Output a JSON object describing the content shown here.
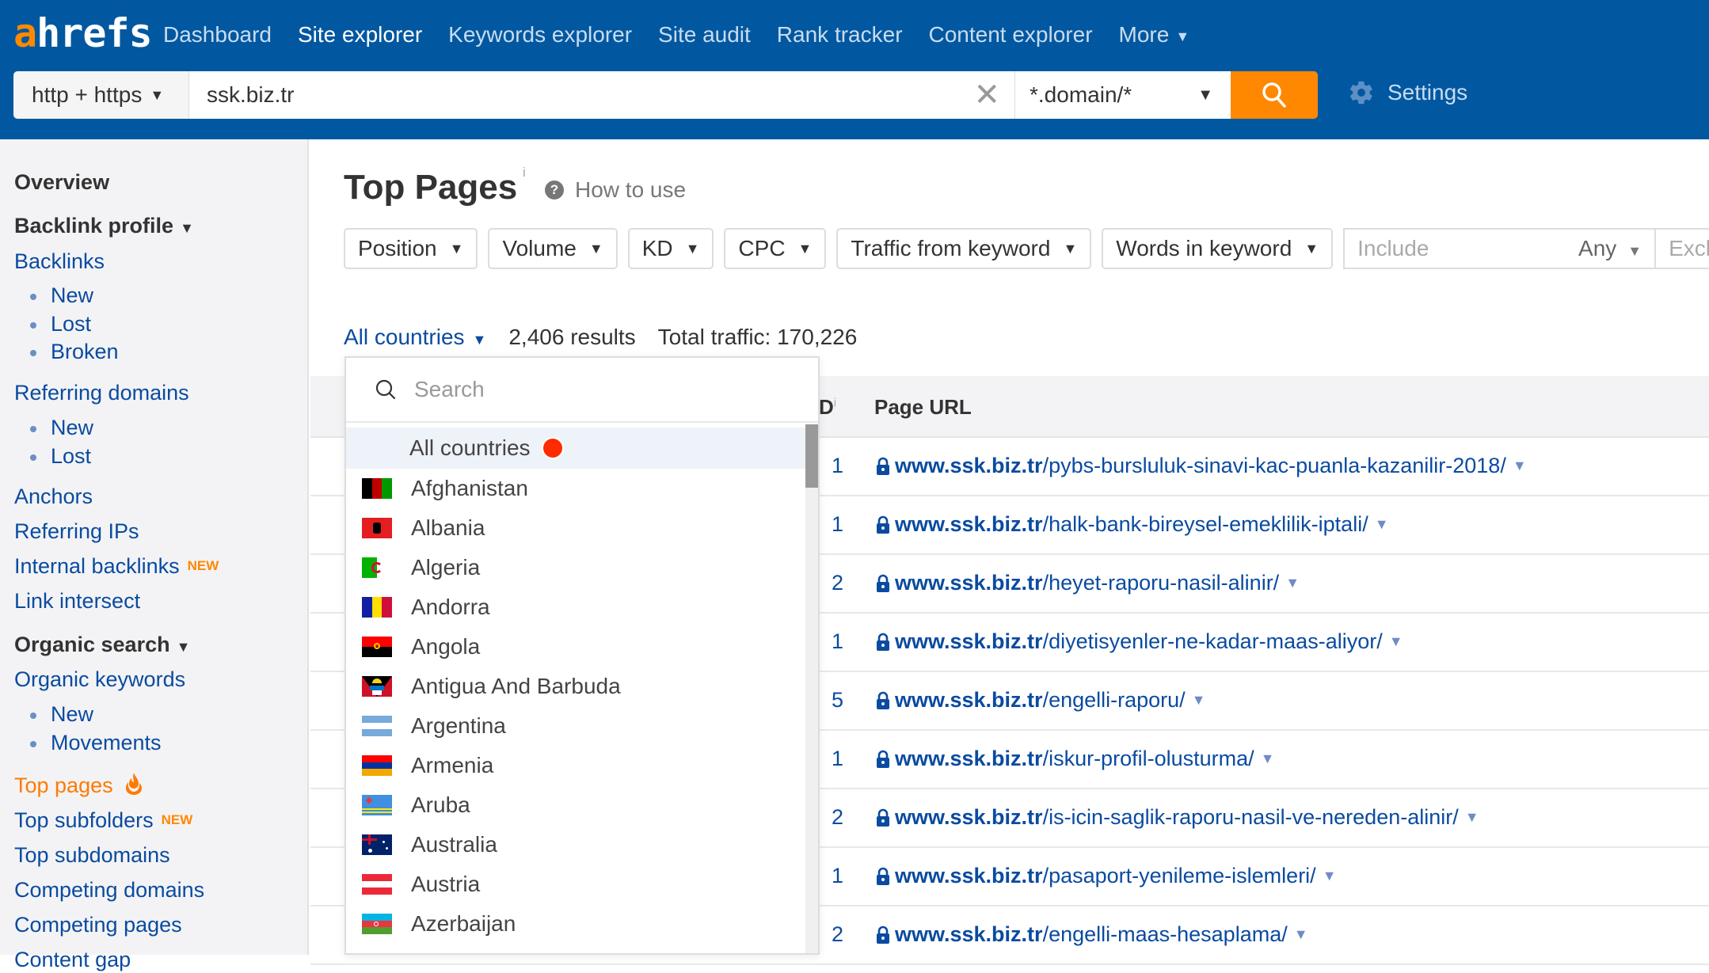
{
  "app": {
    "logo_a": "a",
    "logo_rest": "hrefs",
    "brand_color": "#0158a0",
    "accent_color": "#ff8800"
  },
  "nav": {
    "items": [
      {
        "label": "Dashboard",
        "active": false
      },
      {
        "label": "Site explorer",
        "active": true
      },
      {
        "label": "Keywords explorer",
        "active": false
      },
      {
        "label": "Site audit",
        "active": false
      },
      {
        "label": "Rank tracker",
        "active": false
      },
      {
        "label": "Content explorer",
        "active": false
      },
      {
        "label": "More",
        "active": false
      }
    ]
  },
  "search": {
    "protocol": "http + https",
    "target_value": "ssk.biz.tr",
    "mode": "*.domain/*",
    "settings_label": "Settings"
  },
  "sidebar": {
    "overview": "Overview",
    "backlink_profile": "Backlink profile",
    "backlinks": "Backlinks",
    "backlinks_new": "New",
    "backlinks_lost": "Lost",
    "backlinks_broken": "Broken",
    "referring_domains": "Referring domains",
    "rd_new": "New",
    "rd_lost": "Lost",
    "anchors": "Anchors",
    "referring_ips": "Referring IPs",
    "internal_backlinks": "Internal backlinks",
    "internal_backlinks_badge": "NEW",
    "link_intersect": "Link intersect",
    "organic_search": "Organic search",
    "organic_keywords": "Organic keywords",
    "ok_new": "New",
    "ok_movements": "Movements",
    "top_pages": "Top pages",
    "top_subfolders": "Top subfolders",
    "top_subfolders_badge": "NEW",
    "top_subdomains": "Top subdomains",
    "competing_domains": "Competing domains",
    "competing_pages": "Competing pages",
    "content_gap": "Content gap"
  },
  "main": {
    "title": "Top Pages",
    "title_info": "i",
    "how_to_use": "How to use",
    "filters": [
      "Position",
      "Volume",
      "KD",
      "CPC",
      "Traffic from keyword",
      "Words in keyword"
    ],
    "include_placeholder": "Include",
    "include_mode": "Any",
    "exclude_placeholder": "Exclude",
    "countries_label": "All countries",
    "results": "2,406 results",
    "total_traffic": "Total traffic: 170,226",
    "table": {
      "kd_header": "D",
      "kd_info": "i",
      "url_header": "Page URL",
      "rows": [
        {
          "kd": "1",
          "domain": "www.ssk.biz.tr",
          "path": "/pybs-bursluluk-sinavi-kac-puanla-kazanilir-2018/"
        },
        {
          "kd": "1",
          "domain": "www.ssk.biz.tr",
          "path": "/halk-bank-bireysel-emeklilik-iptali/"
        },
        {
          "kd": "2",
          "domain": "www.ssk.biz.tr",
          "path": "/heyet-raporu-nasil-alinir/"
        },
        {
          "kd": "1",
          "domain": "www.ssk.biz.tr",
          "path": "/diyetisyenler-ne-kadar-maas-aliyor/"
        },
        {
          "kd": "5",
          "domain": "www.ssk.biz.tr",
          "path": "/engelli-raporu/"
        },
        {
          "kd": "1",
          "domain": "www.ssk.biz.tr",
          "path": "/iskur-profil-olusturma/"
        },
        {
          "kd": "2",
          "domain": "www.ssk.biz.tr",
          "path": "/is-icin-saglik-raporu-nasil-ve-nereden-alinir/"
        },
        {
          "kd": "1",
          "domain": "www.ssk.biz.tr",
          "path": "/pasaport-yenileme-islemleri/"
        },
        {
          "kd": "2",
          "domain": "www.ssk.biz.tr",
          "path": "/engelli-maas-hesaplama/"
        }
      ]
    }
  },
  "country_dropdown": {
    "search_placeholder": "Search",
    "selected": "All countries",
    "countries": [
      {
        "name": "Afghanistan",
        "flag": "af"
      },
      {
        "name": "Albania",
        "flag": "al"
      },
      {
        "name": "Algeria",
        "flag": "dz"
      },
      {
        "name": "Andorra",
        "flag": "ad"
      },
      {
        "name": "Angola",
        "flag": "ao"
      },
      {
        "name": "Antigua And Barbuda",
        "flag": "ag"
      },
      {
        "name": "Argentina",
        "flag": "ar"
      },
      {
        "name": "Armenia",
        "flag": "am"
      },
      {
        "name": "Aruba",
        "flag": "aw"
      },
      {
        "name": "Australia",
        "flag": "au"
      },
      {
        "name": "Austria",
        "flag": "at"
      },
      {
        "name": "Azerbaijan",
        "flag": "az"
      }
    ]
  }
}
